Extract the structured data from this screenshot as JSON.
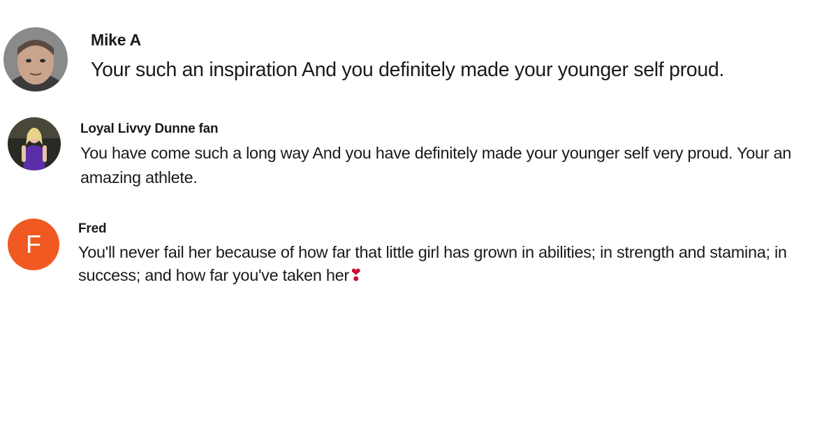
{
  "comments": [
    {
      "author": "Mike A",
      "text": "Your such an inspiration And you definitely made your younger self proud.",
      "avatar": {
        "type": "photo",
        "icon": "user-photo-icon"
      }
    },
    {
      "author": "Loyal Livvy Dunne fan",
      "text": "You have come such a long way And you have definitely made your younger self very proud. Your an amazing athlete.",
      "avatar": {
        "type": "photo",
        "icon": "user-photo-icon"
      }
    },
    {
      "author": "Fred",
      "text": "You'll never fail her because of how far that little girl has grown in abilities; in strength and stamina; in success; and how far you've taken her",
      "emoji": "❣",
      "avatar": {
        "type": "letter",
        "letter": "F",
        "color": "#f05a22"
      }
    }
  ]
}
